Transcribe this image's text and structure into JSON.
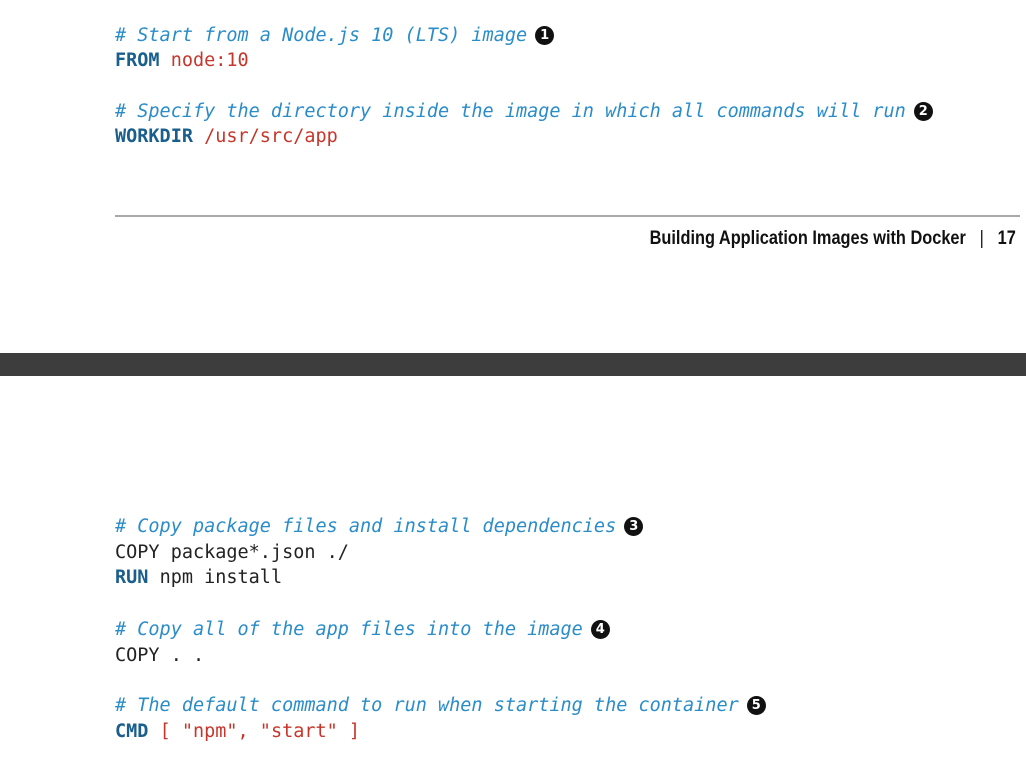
{
  "top_page": {
    "lines": [
      {
        "comment": "# Start from a Node.js 10 (LTS) image",
        "callout": "1"
      },
      {
        "keyword": "FROM",
        "value": "node:10"
      },
      {
        "comment": "# Specify the directory inside the image in which all commands will run",
        "callout": "2"
      },
      {
        "keyword": "WORKDIR",
        "value": "/usr/src/app"
      }
    ],
    "footer": {
      "title": "Building Application Images with Docker",
      "separator": "|",
      "page_number": "17"
    }
  },
  "bottom_page": {
    "lines": [
      {
        "comment": "# Copy package files and install dependencies",
        "callout": "3"
      },
      {
        "plain": "COPY package*.json ./"
      },
      {
        "keyword": "RUN",
        "plain": "npm install"
      },
      {
        "comment": "# Copy all of the app files into the image",
        "callout": "4"
      },
      {
        "plain": "COPY . ."
      },
      {
        "comment": "# The default command to run when starting the container",
        "callout": "5"
      },
      {
        "keyword": "CMD",
        "value": "[ \"npm\", \"start\" ]"
      }
    ]
  },
  "colors": {
    "comment": "#2a8cc9",
    "keyword": "#1a5f8c",
    "string": "#c7362b",
    "text": "#222222",
    "page_gap": "#3d3d3d"
  }
}
